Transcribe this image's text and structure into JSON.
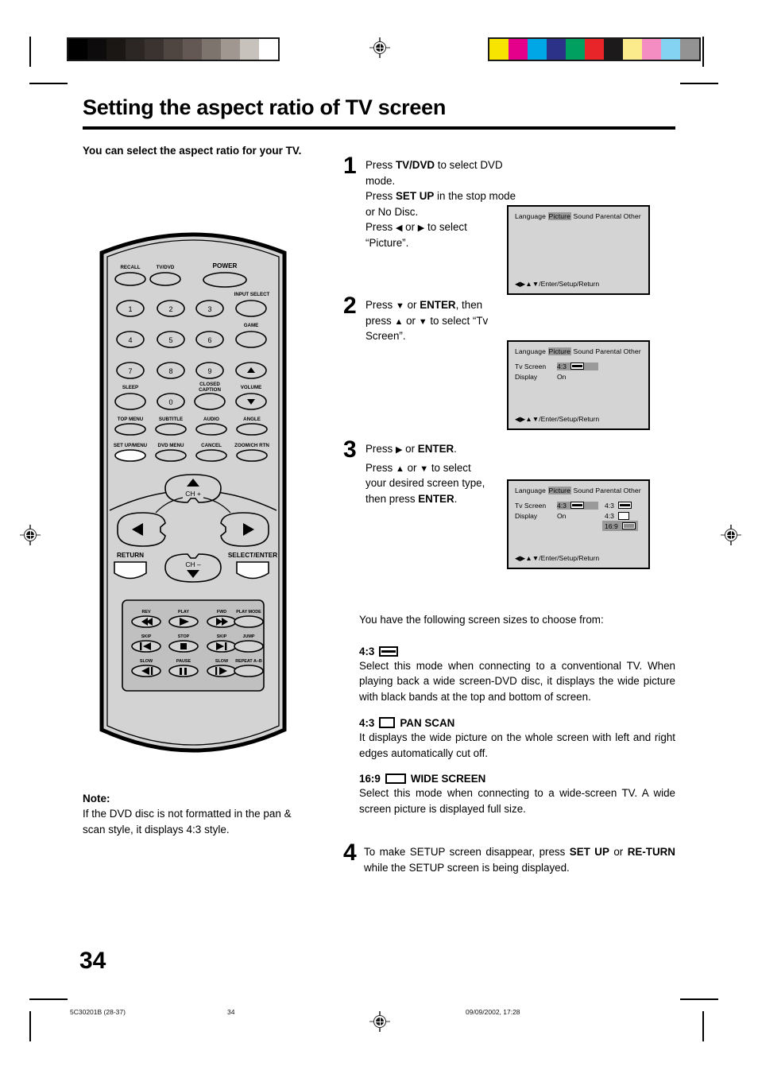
{
  "document": {
    "title": "Setting the aspect ratio of TV screen",
    "lead_in": "You can select the aspect ratio for your TV.",
    "page_number": "34"
  },
  "note": {
    "heading": "Note:",
    "text": "If the DVD disc is not formatted in the pan & scan style, it displays 4:3 style."
  },
  "steps": [
    {
      "number": "1",
      "line1_a": "Press ",
      "line1_b": "TV/DVD",
      "line1_c": " to select DVD mode.",
      "line2_a": "Press ",
      "line2_b": "SET UP",
      "line2_c": " in the stop mode or No Disc.",
      "line3_a": "Press ",
      "line3_arrow_left": "◀",
      "line3_b": " or ",
      "line3_arrow_right": "▶",
      "line3_c": " to select",
      "line4": "“Picture”."
    },
    {
      "number": "2",
      "line1_a": "Press ",
      "arrow_down": "▼",
      "line1_b": " or ",
      "enter_label": "ENTER",
      "line1_c": ", then",
      "line2_a": "press ",
      "arrow_up": "▲",
      "line2_b": " or ",
      "line2_c": " to select “Tv",
      "line3": "Screen”."
    },
    {
      "number": "3",
      "line1_a": "Press ",
      "arrow_right": "▶",
      "line1_b": " or ",
      "enter_label": "ENTER",
      "line1_c": ".",
      "line2_a": "Press ",
      "arrow_up": "▲",
      "line2_b": " or ",
      "arrow_down": "▼",
      "line2_c": " to select",
      "line3": "your desired screen type,",
      "line4_a": "then press ",
      "line4_b": "ENTER",
      "line4_c": "."
    },
    {
      "number": "4",
      "text_a": "To make SETUP screen disappear, press ",
      "text_b": "SET UP",
      "text_c": " or ",
      "text_d": "RE-TURN",
      "text_e": " while the SETUP screen is being displayed."
    }
  ],
  "osd": {
    "tabs": [
      "Language",
      "Picture",
      "Sound",
      "Parental",
      "Other"
    ],
    "selected_tab": "Picture",
    "footer": "◀▶▲▼/Enter/Setup/Return",
    "rows": [
      {
        "label": "Tv Screen",
        "value": "4:3"
      },
      {
        "label": "Display",
        "value": "On"
      }
    ],
    "menu_options": [
      {
        "label": "4:3",
        "icon": "letterbox-icon",
        "highlighted": false
      },
      {
        "label": "4:3",
        "icon": "panscan-icon",
        "highlighted": false
      },
      {
        "label": "16:9",
        "icon": "widescreen-icon",
        "highlighted": true
      }
    ]
  },
  "screen_sizes": {
    "intro": "You have the following screen sizes to choose from:",
    "items": [
      {
        "label": "4:3",
        "suffix": "",
        "icon": "letterbox-icon",
        "body": "Select this mode when connecting to a conventional TV. When playing back a wide screen-DVD disc, it displays the wide picture with black bands at the top and bottom of screen."
      },
      {
        "label": "4:3",
        "suffix": "PAN SCAN",
        "icon": "panscan-icon",
        "body": "It displays the wide picture on the whole screen with left and right edges automatically cut off."
      },
      {
        "label": "16:9",
        "suffix": "WIDE SCREEN",
        "icon": "widescreen-icon",
        "body": "Select this mode when connecting to a wide-screen TV. A wide screen picture is displayed full size."
      }
    ]
  },
  "remote": {
    "row_top": [
      "RECALL",
      "TV/DVD",
      "POWER"
    ],
    "side_labels": [
      "INPUT SELECT",
      "GAME"
    ],
    "numbers": [
      "1",
      "2",
      "3",
      "4",
      "5",
      "6",
      "7",
      "8",
      "9",
      "0"
    ],
    "labels_sleep_row": [
      "SLEEP",
      "CLOSED CAPTION",
      "VOLUME"
    ],
    "labels_menu_row": [
      "TOP MENU",
      "SUBTITLE",
      "AUDIO",
      "ANGLE"
    ],
    "labels_setup_row": [
      "SET UP/MENU",
      "DVD MENU",
      "CANCEL",
      "ZOOM/CH RTN"
    ],
    "ch_up": "CH +",
    "ch_down": "CH –",
    "return_label": "RETURN",
    "select_enter_label": "SELECT/ENTER",
    "transport": [
      {
        "label": "REV",
        "glyph": "◀◀"
      },
      {
        "label": "PLAY",
        "glyph": "▶"
      },
      {
        "label": "FWD",
        "glyph": "▶▶"
      },
      {
        "label": "PLAY MODE",
        "glyph": ""
      },
      {
        "label": "SKIP",
        "glyph": "◀◀|"
      },
      {
        "label": "STOP",
        "glyph": "■"
      },
      {
        "label": "SKIP",
        "glyph": "|▶▶"
      },
      {
        "label": "JUMP",
        "glyph": ""
      },
      {
        "label": "SLOW",
        "glyph": "◀|"
      },
      {
        "label": "PAUSE",
        "glyph": "▐▌"
      },
      {
        "label": "SLOW",
        "glyph": "|▶"
      },
      {
        "label": "REPEAT A–B",
        "glyph": ""
      }
    ]
  },
  "print_marks": {
    "gray_bar": [
      "#000000",
      "#0d0b0b",
      "#1b1715",
      "#2c2724",
      "#3b3330",
      "#4f4641",
      "#635853",
      "#7e746e",
      "#a09790",
      "#c8c2bc",
      "#ffffff"
    ],
    "color_bar": [
      "#f7e400",
      "#e5008c",
      "#00a7e6",
      "#2b3287",
      "#00a060",
      "#e8262a",
      "#1c1a1a",
      "#fbeb8c",
      "#f48ec2",
      "#85d3f3",
      "#939393"
    ]
  },
  "footer": {
    "doc_code": "5C30201B (28-37)",
    "page": "34",
    "timestamp": "09/09/2002, 17:28"
  }
}
